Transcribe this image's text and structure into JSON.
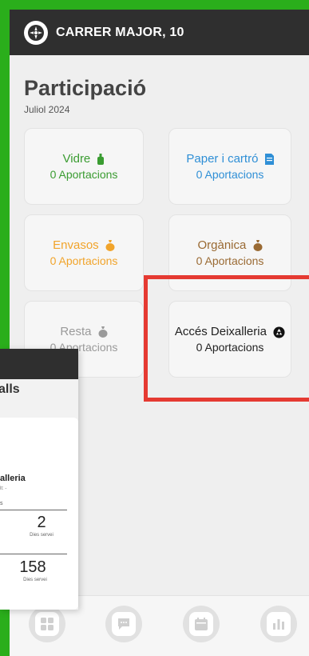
{
  "header": {
    "title": "CARRER MAJOR, 10"
  },
  "page": {
    "title": "Participació",
    "subtitle": "Juliol 2024"
  },
  "cards": [
    {
      "title": "Vidre",
      "count": "0 Aportacions",
      "icon": "bottle-icon",
      "color": "#3a9c31"
    },
    {
      "title": "Paper i cartró",
      "count": "0 Aportacions",
      "icon": "paper-icon",
      "color": "#2f8fd6"
    },
    {
      "title": "Envasos",
      "count": "0 Aportacions",
      "icon": "bag-icon",
      "color": "#f1a42b"
    },
    {
      "title": "Orgànica",
      "count": "0 Aportacions",
      "icon": "bag-icon",
      "color": "#9a6a33"
    },
    {
      "title": "Resta",
      "count": "0 Aportacions",
      "icon": "bag-icon",
      "color": "#9a9a9a"
    },
    {
      "title": "Accés Deixalleria",
      "count": "0 Aportacions",
      "icon": "recycle-icon",
      "color": "#222222"
    }
  ],
  "overlay": {
    "title": "alls",
    "card_title": "alleria",
    "card_sub": "lt: -",
    "small_label": "s",
    "stat1": {
      "value": "2",
      "label": "Dies servei"
    },
    "stat2": {
      "value": "158",
      "label": "Dies servei"
    }
  },
  "nav": [
    "grid-icon",
    "chat-icon",
    "calendar-icon",
    "chart-icon"
  ],
  "colors": {
    "accent_green": "#2aae1b",
    "header": "#2f2f2f",
    "highlight": "#e53a32"
  }
}
